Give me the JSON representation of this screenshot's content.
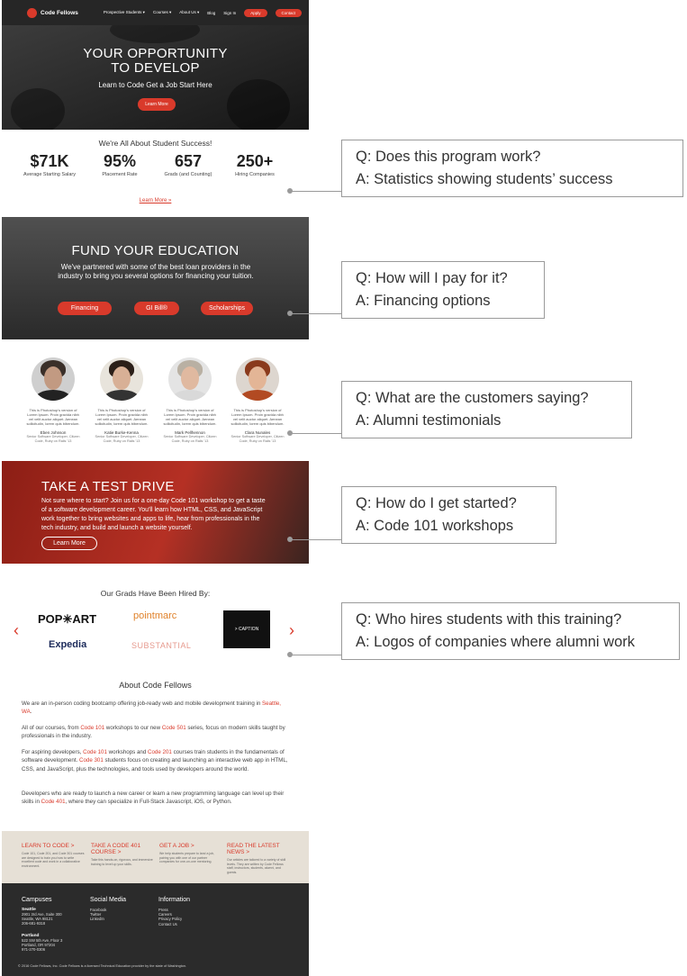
{
  "nav": {
    "brand": "Code Fellows",
    "links": [
      "Prospective Students ▾",
      "Courses ▾",
      "About Us ▾",
      "Blog",
      "Sign In"
    ],
    "apply": "Apply",
    "contact": "Contact"
  },
  "hero": {
    "title_line1": "YOUR OPPORTUNITY",
    "title_line2": "TO DEVELOP",
    "subtitle": "Learn to Code  Get a Job  Start Here",
    "button": "Learn More"
  },
  "stats": {
    "title": "We're All About Student Success!",
    "items": [
      {
        "value": "$71K",
        "label": "Average Starting Salary"
      },
      {
        "value": "95%",
        "label": "Placement Rate"
      },
      {
        "value": "657",
        "label": "Grads (and Counting)"
      },
      {
        "value": "250+",
        "label": "Hiring Companies"
      }
    ],
    "more": "Learn More »"
  },
  "fund": {
    "title": "FUND YOUR EDUCATION",
    "body": "We've partnered with some of the best loan providers in the industry to bring you several options for financing your tuition.",
    "buttons": [
      "Financing",
      "GI Bill®",
      "Scholarships"
    ]
  },
  "testimonials": {
    "quote": "This is Photoshop's version of Lorem Ipsum. Proin gravida nibh vel velit auctor aliquet. Aenean sollicitudin, lorem quis bibendum.",
    "people": [
      {
        "name": "Eben Johnson",
        "title": "Senior Software Developer, Citizen Code, Ruby on Rails '13"
      },
      {
        "name": "Katie Burke-Kenna",
        "title": "Senior Software Developer, Citizen Code, Ruby on Rails '13"
      },
      {
        "name": "Mark Pellhennon",
        "title": "Senior Software Developer, Citizen Code, Ruby on Rails '13"
      },
      {
        "name": "Clara Nunales",
        "title": "Senior Software Developer, Citizen Code, Ruby on Rails '13"
      }
    ]
  },
  "test_drive": {
    "title": "TAKE A TEST DRIVE",
    "body": "Not sure where to start? Join us for a one-day Code 101 workshop to get a taste of a software development career. You'll learn how HTML, CSS, and JavaScript work together to bring websites and apps to life, hear from professionals in the tech industry, and build and launch a website yourself.",
    "button": "Learn More"
  },
  "hired": {
    "title": "Our Grads Have Been Hired By:",
    "logos": [
      "POP✳ART",
      "pointmarc",
      "Expedia",
      "SUBSTANTIAL"
    ],
    "dark_logo": "> CAPTION",
    "left_arrow": "‹",
    "right_arrow": "›"
  },
  "about": {
    "title": "About Code Fellows",
    "p1a": "We are an in-person coding bootcamp offering job-ready web and mobile development training in ",
    "p1link": "Seattle, WA",
    "p1b": ".",
    "p2a": "All of our courses, from ",
    "p2link1": "Code 101",
    "p2b": " workshops to our new ",
    "p2link2": "Code 501",
    "p2c": " series, focus on modern skills taught by professionals in the industry.",
    "p3a": "For aspiring developers, ",
    "p3link1": "Code 101",
    "p3b": " workshops and ",
    "p3link2": "Code 201",
    "p3c": " courses train students in the fundamentals of software development. ",
    "p3link3": "Code 301",
    "p3d": " students focus on creating and launching an interactive web app in HTML, CSS, and JavaScript, plus the technologies, and tools used by developers around the world.",
    "p4a": "Developers who are ready to launch a new career or learn a new programming language can level up their skills in ",
    "p4link": "Code 401",
    "p4b": ", where they can specialize in Full-Stack Javascript, iOS, or Python."
  },
  "promo": [
    {
      "heading": "LEARN TO CODE >",
      "body": "Code 101, Code 201, and Code 301 courses are designed to train you how to write excellent code and work in a collaborative environment."
    },
    {
      "heading": "TAKE A CODE 401 COURSE >",
      "body": "Take this hands-on, rigorous, and immersive training to level up your skills."
    },
    {
      "heading": "GET A JOB >",
      "body": "We help students prepare to land a job, pairing you with one of our partner companies for one-on-one mentoring."
    },
    {
      "heading": "READ THE LATEST NEWS >",
      "body": "Our articles are tailored to a variety of skill levels. They are written by Code Fellows staff, instructors, students, alumni, and guests."
    }
  ],
  "footer": {
    "campuses_head": "Campuses",
    "seattle": "Seattle",
    "seattle_addr": [
      "2901 3rd Ave, Suite 300",
      "Seattle, WA 98121",
      "206-681-9318"
    ],
    "portland": "Portland",
    "portland_addr": [
      "522 SW 5th Ave, Floor 3",
      "Portland, OR 97204",
      "971-270-0306"
    ],
    "social_head": "Social Media",
    "social": [
      "Facebook",
      "Twitter",
      "LinkedIn"
    ],
    "info_head": "Information",
    "info": [
      "Press",
      "Careers",
      "Privacy Policy",
      "Contact Us"
    ],
    "copyright": "© 2016 Code Fellows, Inc. Code Fellows is a licensed Technical Education provider by the state of Washington."
  },
  "annotations": [
    {
      "q": "Q: Does this program work?",
      "a": "A: Statistics showing students’ success"
    },
    {
      "q": "Q: How will I pay for it?",
      "a": "A: Financing options"
    },
    {
      "q": "Q: What are the customers saying?",
      "a": "A: Alumni testimonials"
    },
    {
      "q": "Q: How do I get started?",
      "a": "A: Code 101 workshops"
    },
    {
      "q": "Q: Who hires students with this training?",
      "a": "A: Logos of companies where alumni work"
    }
  ],
  "colors": {
    "brand_red": "#d93a2b",
    "connector_gray": "#9a9a9a"
  }
}
